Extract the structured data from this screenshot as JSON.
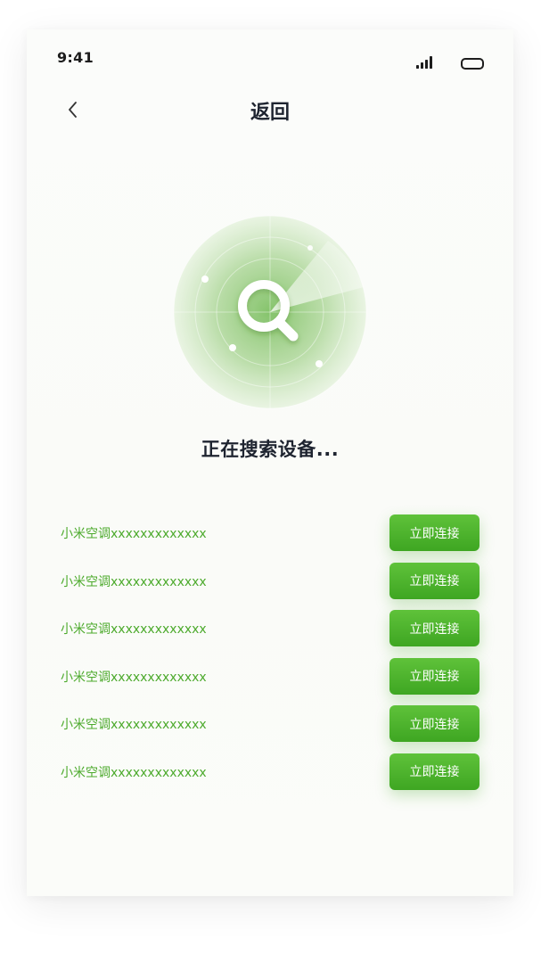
{
  "status_bar": {
    "time": "9:41",
    "signal_icon": "signal-icon",
    "battery_icon": "battery-icon"
  },
  "header": {
    "back_icon": "chevron-left-icon",
    "title": "返回"
  },
  "radar": {
    "icon": "search-icon",
    "accent_color": "#5cb83a"
  },
  "status": {
    "searching_text": "正在搜索设备..."
  },
  "devices": [
    {
      "name": "小米空调xxxxxxxxxxxxx",
      "button_label": "立即连接"
    },
    {
      "name": "小米空调xxxxxxxxxxxxx",
      "button_label": "立即连接"
    },
    {
      "name": "小米空调xxxxxxxxxxxxx",
      "button_label": "立即连接"
    },
    {
      "name": "小米空调xxxxxxxxxxxxx",
      "button_label": "立即连接"
    },
    {
      "name": "小米空调xxxxxxxxxxxxx",
      "button_label": "立即连接"
    },
    {
      "name": "小米空调xxxxxxxxxxxxx",
      "button_label": "立即连接"
    }
  ],
  "colors": {
    "accent": "#4caa2c",
    "button": "#4db22d",
    "title_text": "#1e2430"
  }
}
